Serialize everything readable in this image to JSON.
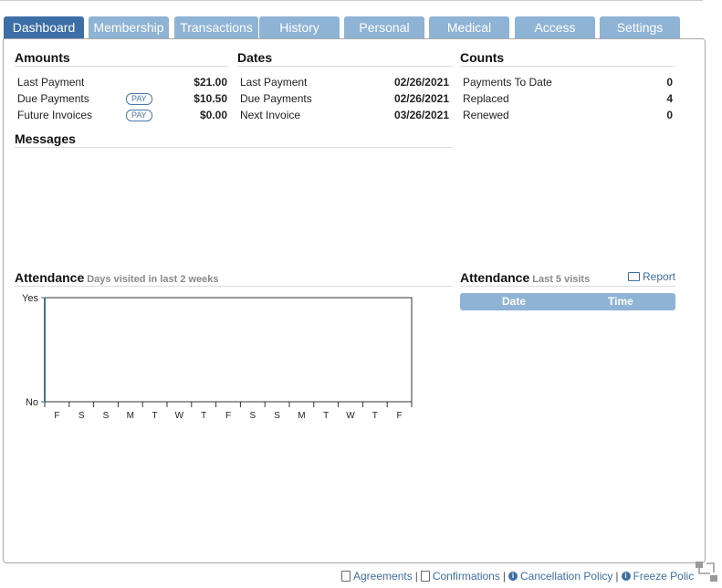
{
  "tabs": [
    {
      "label": "Dashboard",
      "active": true
    },
    {
      "label": "Membership"
    },
    {
      "label": "Transactions"
    },
    {
      "label": "History"
    },
    {
      "label": "Personal"
    },
    {
      "label": "Medical"
    },
    {
      "label": "Access"
    },
    {
      "label": "Settings"
    }
  ],
  "amounts": {
    "title": "Amounts",
    "pay_label": "PAY",
    "rows": [
      {
        "label": "Last Payment",
        "value": "$21.00"
      },
      {
        "label": "Due Payments",
        "value": "$10.50"
      },
      {
        "label": "Future Invoices",
        "value": "$0.00"
      }
    ]
  },
  "dates": {
    "title": "Dates",
    "rows": [
      {
        "label": "Last Payment",
        "value": "02/26/2021"
      },
      {
        "label": "Due Payments",
        "value": "02/26/2021"
      },
      {
        "label": "Next Invoice",
        "value": "03/26/2021"
      }
    ]
  },
  "counts": {
    "title": "Counts",
    "rows": [
      {
        "label": "Payments To Date",
        "value": "0"
      },
      {
        "label": "Replaced",
        "value": "4"
      },
      {
        "label": "Renewed",
        "value": "0"
      }
    ]
  },
  "messages": {
    "title": "Messages"
  },
  "attendance_chart": {
    "title": "Attendance",
    "subtitle": "Days visited in last 2 weeks"
  },
  "attendance_list": {
    "title": "Attendance",
    "subtitle": "Last 5 visits",
    "report_label": "Report",
    "columns": [
      "Date",
      "Time"
    ]
  },
  "chart_data": {
    "type": "bar",
    "title": "Attendance",
    "subtitle": "Days visited in last 2 weeks",
    "categories": [
      "F",
      "S",
      "S",
      "M",
      "T",
      "W",
      "T",
      "F",
      "S",
      "S",
      "M",
      "T",
      "W",
      "T",
      "F"
    ],
    "values": [
      0,
      0,
      0,
      0,
      0,
      0,
      0,
      0,
      0,
      0,
      0,
      0,
      0,
      0,
      0
    ],
    "y_tick_labels": [
      "No",
      "Yes"
    ],
    "ylim": [
      0,
      1
    ],
    "grid": false,
    "colors": {
      "axis": "#4a6f8a",
      "frame": "#333333"
    }
  },
  "footer": {
    "links": [
      {
        "label": "Agreements",
        "icon": "pdf-icon"
      },
      {
        "label": "Confirmations",
        "icon": "pdf-icon"
      },
      {
        "label": "Cancellation Policy",
        "icon": "info-icon"
      },
      {
        "label": "Freeze Polic",
        "icon": "info-icon"
      }
    ],
    "separator": "|"
  }
}
